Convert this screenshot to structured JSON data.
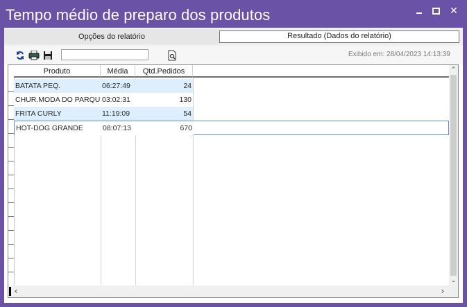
{
  "window": {
    "title": "Tempo médio de preparo dos produtos",
    "close_glyph": "✕"
  },
  "tabs": [
    {
      "label": "Opções do relatório"
    },
    {
      "label": "Resultado (Dados do relatório)"
    }
  ],
  "toolbar": {
    "search_value": "",
    "exibido_em": "Exibido em: 28/04/2023 14:13:39",
    "icons": [
      "refresh-icon",
      "print-icon",
      "save-icon",
      "search-doc-icon"
    ]
  },
  "grid": {
    "columns": [
      "Produto",
      "Média",
      "Qtd.Pedidos"
    ],
    "rows": [
      {
        "produto": "BATATA PEQ.",
        "media": "06:27:49",
        "qtd": "24"
      },
      {
        "produto": "CHUR.MODA DO PARQUE",
        "media": "03:02:31",
        "qtd": "130"
      },
      {
        "produto": "FRITA CURLY",
        "media": "11:19:09",
        "qtd": "54"
      },
      {
        "produto": "HOT-DOG GRANDE",
        "media": "08:07:13",
        "qtd": "670"
      }
    ],
    "scroll": {
      "up": "⌃",
      "down": "⌄",
      "left": "‹",
      "right": "›"
    }
  },
  "colors": {
    "titlebar": "#6a52a6",
    "row_alt": "#ddeffc",
    "selected_border": "#5f8fb5"
  }
}
